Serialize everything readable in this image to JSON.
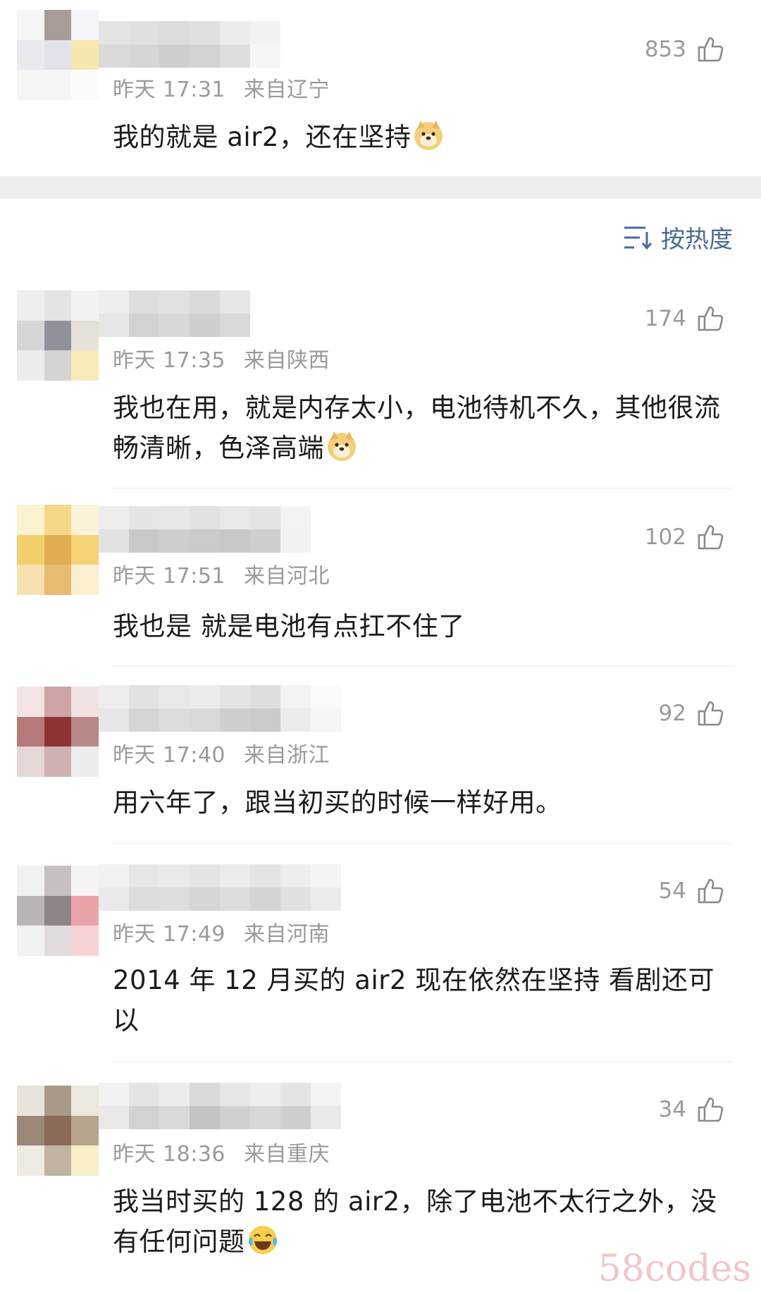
{
  "sort": {
    "label": "按热度",
    "icon": "sort-icon"
  },
  "comments": [
    {
      "time": "昨天 17:31",
      "location": "来自辽宁",
      "likes": "853",
      "text": "我的就是 air2，还在坚持",
      "emoji": "doge"
    },
    {
      "time": "昨天 17:35",
      "location": "来自陕西",
      "likes": "174",
      "text": "我也在用，就是内存太小，电池待机不久，其他很流畅清晰，色泽高端",
      "emoji": "doge"
    },
    {
      "time": "昨天 17:51",
      "location": "来自河北",
      "likes": "102",
      "text": "我也是 就是电池有点扛不住了"
    },
    {
      "time": "昨天 17:40",
      "location": "来自浙江",
      "likes": "92",
      "text": "用六年了，跟当初买的时候一样好用。"
    },
    {
      "time": "昨天 17:49",
      "location": "来自河南",
      "likes": "54",
      "text": "2014 年 12 月买的 air2 现在依然在坚持 看剧还可以"
    },
    {
      "time": "昨天 18:36",
      "location": "来自重庆",
      "likes": "34",
      "text": "我当时买的 128 的 air2，除了电池不太行之外，没有任何问题",
      "emoji": "laugh-cry"
    }
  ],
  "watermark": "58codes",
  "colors": {
    "link": "#4b6a94",
    "meta": "#9a9a9a",
    "separator": "#eeeeee"
  }
}
